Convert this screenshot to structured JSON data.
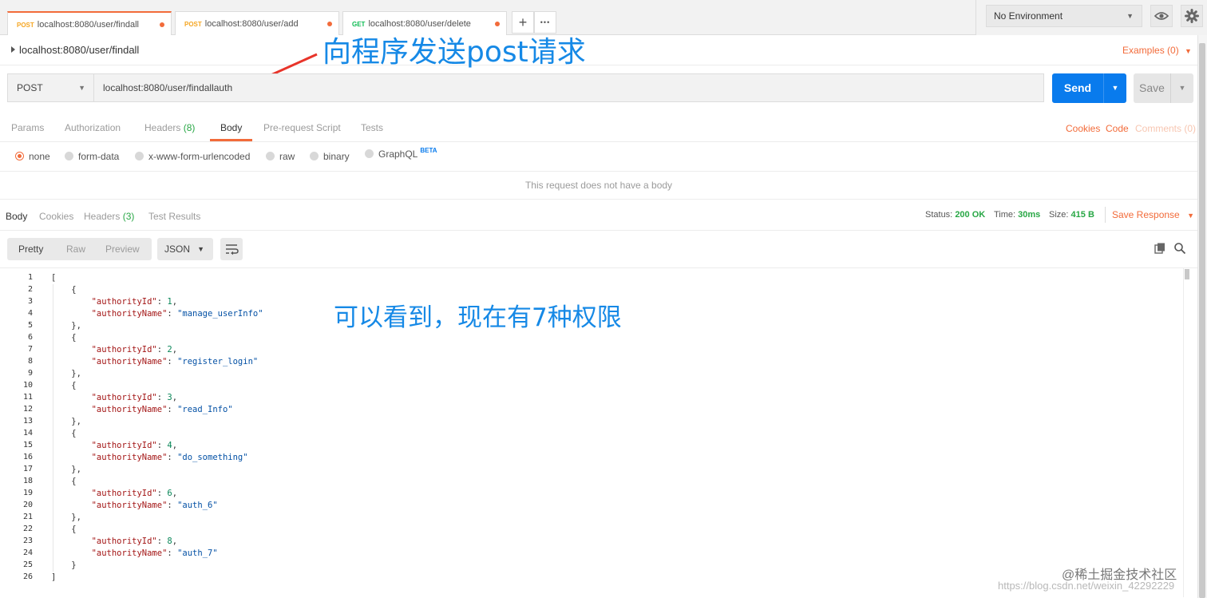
{
  "tabs": [
    {
      "method": "POST",
      "url": "localhost:8080/user/findall"
    },
    {
      "method": "POST",
      "url": "localhost:8080/user/add"
    },
    {
      "method": "GET",
      "url": "localhost:8080/user/delete"
    }
  ],
  "tabbar": {
    "add_label": "+",
    "more_label": "•••"
  },
  "environment": {
    "selected": "No Environment"
  },
  "request": {
    "title": "localhost:8080/user/findall",
    "examples_label": "Examples (0)",
    "method": "POST",
    "url": "localhost:8080/user/findallauth",
    "send_label": "Send",
    "save_label": "Save",
    "tabs": {
      "params": "Params",
      "authorization": "Authorization",
      "headers": "Headers",
      "headers_count": "(8)",
      "body": "Body",
      "prerequest": "Pre-request Script",
      "tests": "Tests"
    },
    "links": {
      "cookies": "Cookies",
      "code": "Code",
      "comments": "Comments (0)"
    },
    "body_types": [
      "none",
      "form-data",
      "x-www-form-urlencoded",
      "raw",
      "binary",
      "GraphQL"
    ],
    "beta_badge": "BETA",
    "no_body_text": "This request does not have a body"
  },
  "response": {
    "tabs": {
      "body": "Body",
      "cookies": "Cookies",
      "headers": "Headers",
      "headers_count": "(3)",
      "tests": "Test Results"
    },
    "status_label": "Status:",
    "status_value": "200 OK",
    "time_label": "Time:",
    "time_value": "30ms",
    "size_label": "Size:",
    "size_value": "415 B",
    "save_label": "Save Response",
    "format_tabs": [
      "Pretty",
      "Raw",
      "Preview"
    ],
    "format_select": "JSON",
    "body": [
      {
        "authorityId": "1",
        "authorityName": "\"manage_userInfo\""
      },
      {
        "authorityId": "2",
        "authorityName": "\"register_login\""
      },
      {
        "authorityId": "3",
        "authorityName": "\"read_Info\""
      },
      {
        "authorityId": "4",
        "authorityName": "\"do_something\""
      },
      {
        "authorityId": "6",
        "authorityName": "\"auth_6\""
      },
      {
        "authorityId": "8",
        "authorityName": "\"auth_7\""
      }
    ],
    "key_id": "\"authorityId\"",
    "key_name": "\"authorityName\""
  },
  "annotations": {
    "top": "向程序发送post请求",
    "middle": "可以看到，现在有7种权限"
  },
  "watermark": {
    "line1": "@稀土掘金技术社区",
    "line2": "https://blog.csdn.net/weixin_42292229"
  },
  "colors": {
    "accent": "#f26b3a",
    "send_blue": "#097bed",
    "status_green": "#28a745",
    "annotation_blue": "#1689e6",
    "arrow_red": "#e8342a"
  },
  "icons": [
    "chevron-right-icon",
    "caret-down-icon",
    "eye-icon",
    "gear-icon",
    "wrap-lines-icon",
    "copy-icon",
    "search-icon",
    "red-arrow-annotation"
  ]
}
